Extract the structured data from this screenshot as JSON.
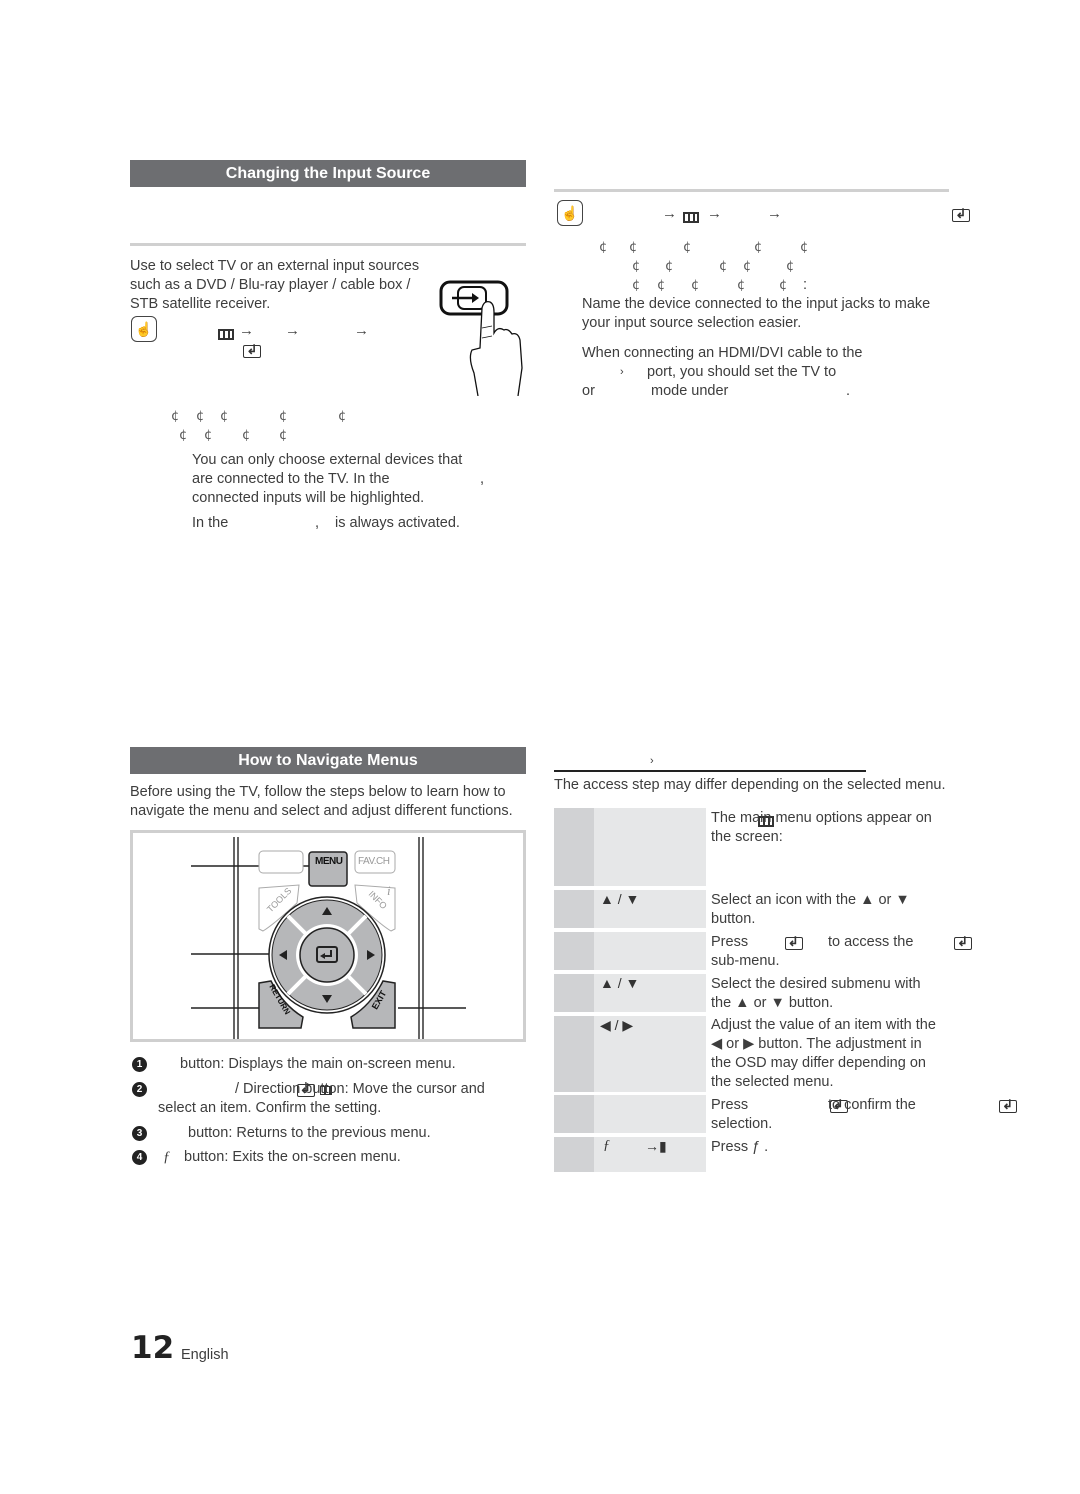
{
  "page": {
    "number": "12",
    "language": "English"
  },
  "input_source": {
    "title": "Changing the Input Source",
    "intro_lines": [
      "Use to select TV or an external input sources",
      "such as a DVD / Blu-ray player / cable box /",
      "STB satellite receiver."
    ],
    "path_arrows": [
      "→",
      "→",
      "→"
    ],
    "icon_names": [
      "hand-touch-icon",
      "menu-icon",
      "enter-icon",
      "source-button-icon"
    ],
    "cents_row1": [
      "¢",
      "¢",
      "¢",
      "¢",
      "¢"
    ],
    "cents_row2": [
      "¢",
      "¢",
      "¢",
      "¢"
    ],
    "note1_lines": [
      "You can only choose external devices that",
      "are connected to the TV. In the",
      "connected inputs will be highlighted."
    ],
    "note1_comma": ",",
    "note2_prefix": "In the",
    "note2_comma": ",",
    "note2_suffix": "is always activated."
  },
  "edit_name": {
    "path_arrows": [
      "→",
      "→",
      "→"
    ],
    "cents_row1": [
      "¢",
      "¢",
      "¢",
      "¢",
      "¢"
    ],
    "cents_row2": [
      "¢",
      "¢",
      "¢",
      "¢",
      "¢"
    ],
    "cents_row3": [
      "¢",
      "¢",
      "¢",
      "¢",
      "¢"
    ],
    "colon": ":",
    "desc_lines": [
      "Name the device connected to the input jacks to make",
      "your input source selection easier."
    ],
    "hdmi_lines": [
      "When connecting an HDMI/DVI cable to the",
      "port, you should set the TV to",
      "mode under"
    ],
    "hdmi_chevron": "›",
    "hdmi_or": "or",
    "hdmi_period": "."
  },
  "navigate": {
    "title": "How to Navigate Menus",
    "intro_lines": [
      "Before using the TV, follow the steps below to learn how to",
      "navigate the menu and select and adjust different functions."
    ],
    "remote": {
      "menu_label": "MENU",
      "favch_label": "FAV.CH",
      "tools_label": "TOOLS",
      "info_label": "INFO",
      "return_label": "RETURN",
      "exit_label": "EXIT",
      "info_glyph": "i",
      "up": "▲",
      "down": "▼",
      "left": "◀",
      "right": "▶"
    },
    "legend": [
      {
        "num": "1",
        "text": "button: Displays the main on-screen menu."
      },
      {
        "num": "2",
        "text": "/ Direction button: Move the cursor and",
        "text2": "select an item. Confirm the setting."
      },
      {
        "num": "3",
        "text": "button: Returns to the previous menu."
      },
      {
        "num": "4",
        "glyph": "ƒ",
        "text": "button: Exits the on-screen menu."
      }
    ]
  },
  "operation": {
    "heading_chevron": "›",
    "note": "The access step may differ depending on the selected menu.",
    "rows": [
      {
        "key": "",
        "desc": [
          "The main menu options appear on",
          "the screen:"
        ]
      },
      {
        "key": "▲ / ▼",
        "desc": [
          "Select an icon with the ▲ or ▼",
          "button."
        ]
      },
      {
        "key": "",
        "desc_prefix": "Press",
        "desc_suffix": "to access the",
        "desc2": "sub-menu."
      },
      {
        "key": "▲ / ▼",
        "desc": [
          "Select the desired submenu with",
          "the ▲ or ▼ button."
        ]
      },
      {
        "key": "◀ / ▶",
        "desc": [
          "Adjust the value of an item with the",
          "◀ or ▶ button. The adjustment in",
          "the OSD may differ depending on",
          "the selected menu."
        ]
      },
      {
        "key": "",
        "desc_prefix": "Press",
        "desc_suffix": "to confirm the",
        "desc2": "selection."
      },
      {
        "key": "ƒ",
        "key_arrow": "→▮",
        "desc": [
          "Press ƒ ."
        ]
      }
    ]
  }
}
